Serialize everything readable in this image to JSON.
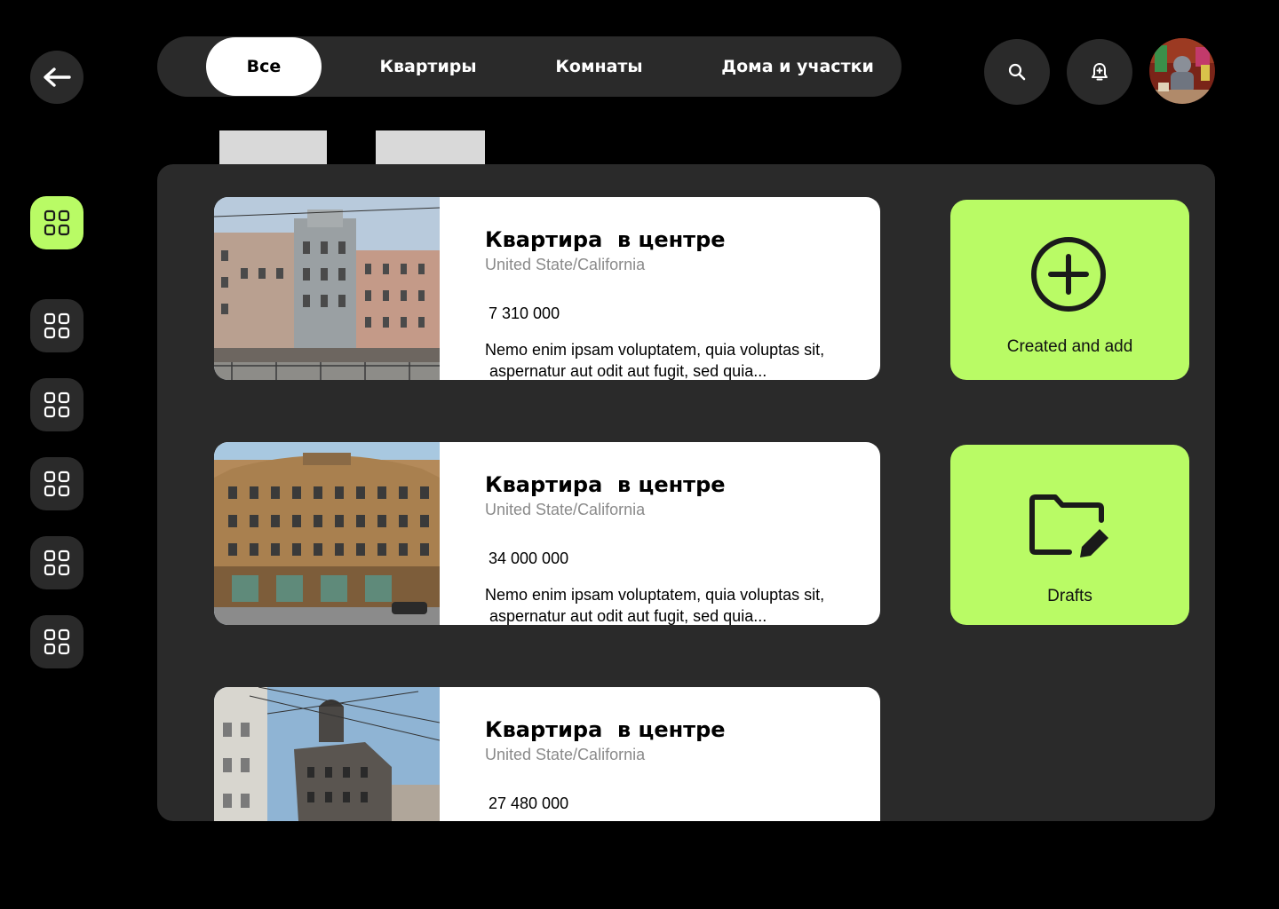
{
  "nav": {
    "tabs": [
      {
        "label": "Все",
        "active": true
      },
      {
        "label": "Квартиры",
        "active": false
      },
      {
        "label": "Комнаты",
        "active": false
      },
      {
        "label": "Дома и участки",
        "active": false
      }
    ]
  },
  "header": {
    "back_icon": "arrow-left-icon",
    "search_icon": "search-icon",
    "notifications_icon": "bell-icon",
    "avatar": "user-avatar"
  },
  "sidebar": {
    "items": [
      {
        "icon": "grid-icon",
        "active": true
      },
      {
        "icon": "grid-icon",
        "active": false
      },
      {
        "icon": "grid-icon",
        "active": false
      },
      {
        "icon": "grid-icon",
        "active": false
      },
      {
        "icon": "grid-icon",
        "active": false
      },
      {
        "icon": "grid-icon",
        "active": false
      }
    ]
  },
  "listings": [
    {
      "title": "Квартира  в центре",
      "location": "United State/California",
      "price": "7 310 000",
      "description": "Nemo enim ipsam voluptatem, quia voluptas sit,\n aspernatur aut odit aut fugit, sed quia..."
    },
    {
      "title": "Квартира  в центре",
      "location": "United State/California",
      "price": "34 000 000",
      "description": "Nemo enim ipsam voluptatem, quia voluptas sit,\n aspernatur aut odit aut fugit, sed quia..."
    },
    {
      "title": "Квартира  в центре",
      "location": "United State/California",
      "price": "27 480 000",
      "description": ""
    }
  ],
  "actions": {
    "create": {
      "label": "Created and add",
      "icon": "plus-circle-icon"
    },
    "drafts": {
      "label": "Drafts",
      "icon": "folder-edit-icon"
    }
  },
  "colors": {
    "accent": "#b9fb65",
    "surface": "#2a2a2a",
    "background": "#000000"
  }
}
